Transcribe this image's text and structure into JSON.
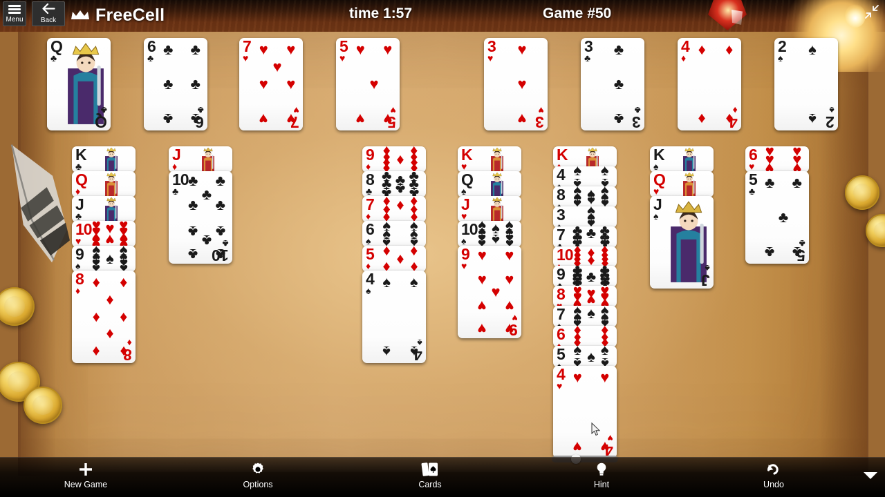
{
  "window": {
    "app_title": "FreeCell",
    "menu_label": "Menu",
    "back_label": "Back",
    "restore_icon": "restore-down-icon",
    "crown_icon": "crown-icon"
  },
  "status": {
    "time_label": "time 1:57",
    "game_label": "Game #50"
  },
  "toolbar": {
    "items": [
      {
        "label": "New Game",
        "icon": "plus-icon"
      },
      {
        "label": "Options",
        "icon": "gear-icon"
      },
      {
        "label": "Cards",
        "icon": "cards-icon"
      },
      {
        "label": "Hint",
        "icon": "lightbulb-icon"
      },
      {
        "label": "Undo",
        "icon": "undo-arrow-icon"
      }
    ],
    "more_icon": "chevron-down-icon"
  },
  "colors": {
    "red_suit": "#d40000",
    "black_suit": "#1a1a1a",
    "card_face": "#ffffff",
    "toolbar_bg": "#000000",
    "table": "#c2914f"
  },
  "board": {
    "free_cells": [
      {
        "rank": "Q",
        "suit": "clubs",
        "symbol": "♣",
        "color": "black",
        "court": true
      },
      {
        "rank": "6",
        "suit": "clubs",
        "symbol": "♣",
        "color": "black",
        "court": false
      },
      {
        "rank": "7",
        "suit": "hearts",
        "symbol": "♥",
        "color": "red",
        "court": false
      },
      {
        "rank": "5",
        "suit": "hearts",
        "symbol": "♥",
        "color": "red",
        "court": false
      }
    ],
    "foundations": [
      {
        "rank": "3",
        "suit": "hearts",
        "symbol": "♥",
        "color": "red",
        "court": false
      },
      {
        "rank": "3",
        "suit": "clubs",
        "symbol": "♣",
        "color": "black",
        "court": false
      },
      {
        "rank": "4",
        "suit": "diamonds",
        "symbol": "♦",
        "color": "red",
        "court": false
      },
      {
        "rank": "2",
        "suit": "spades",
        "symbol": "♠",
        "color": "black",
        "court": false
      }
    ],
    "columns": [
      {
        "cards": [
          {
            "rank": "K",
            "suit": "clubs",
            "symbol": "♣",
            "color": "black",
            "court": true
          },
          {
            "rank": "Q",
            "suit": "diamonds",
            "symbol": "♦",
            "color": "red",
            "court": true
          },
          {
            "rank": "J",
            "suit": "clubs",
            "symbol": "♣",
            "color": "black",
            "court": true
          },
          {
            "rank": "10",
            "suit": "hearts",
            "symbol": "♥",
            "color": "red",
            "court": false
          },
          {
            "rank": "9",
            "suit": "spades",
            "symbol": "♠",
            "color": "black",
            "court": false
          },
          {
            "rank": "8",
            "suit": "diamonds",
            "symbol": "♦",
            "color": "red",
            "court": false
          }
        ]
      },
      {
        "cards": [
          {
            "rank": "J",
            "suit": "diamonds",
            "symbol": "♦",
            "color": "red",
            "court": true
          },
          {
            "rank": "10",
            "suit": "clubs",
            "symbol": "♣",
            "color": "black",
            "court": false
          }
        ]
      },
      {
        "cards": []
      },
      {
        "cards": [
          {
            "rank": "9",
            "suit": "diamonds",
            "symbol": "♦",
            "color": "red",
            "court": false
          },
          {
            "rank": "8",
            "suit": "clubs",
            "symbol": "♣",
            "color": "black",
            "court": false
          },
          {
            "rank": "7",
            "suit": "diamonds",
            "symbol": "♦",
            "color": "red",
            "court": false
          },
          {
            "rank": "6",
            "suit": "spades",
            "symbol": "♠",
            "color": "black",
            "court": false
          },
          {
            "rank": "5",
            "suit": "diamonds",
            "symbol": "♦",
            "color": "red",
            "court": false
          },
          {
            "rank": "4",
            "suit": "spades",
            "symbol": "♠",
            "color": "black",
            "court": false
          }
        ]
      },
      {
        "cards": [
          {
            "rank": "K",
            "suit": "hearts",
            "symbol": "♥",
            "color": "red",
            "court": true
          },
          {
            "rank": "Q",
            "suit": "spades",
            "symbol": "♠",
            "color": "black",
            "court": true
          },
          {
            "rank": "J",
            "suit": "hearts",
            "symbol": "♥",
            "color": "red",
            "court": true
          },
          {
            "rank": "10",
            "suit": "spades",
            "symbol": "♠",
            "color": "black",
            "court": false
          },
          {
            "rank": "9",
            "suit": "hearts",
            "symbol": "♥",
            "color": "red",
            "court": false
          }
        ]
      },
      {
        "cards": [
          {
            "rank": "K",
            "suit": "diamonds",
            "symbol": "♦",
            "color": "red",
            "court": true
          },
          {
            "rank": "4",
            "suit": "spades",
            "symbol": "♠",
            "color": "black",
            "court": false
          },
          {
            "rank": "8",
            "suit": "spades",
            "symbol": "♠",
            "color": "black",
            "court": false
          },
          {
            "rank": "3",
            "suit": "spades",
            "symbol": "♠",
            "color": "black",
            "court": false
          },
          {
            "rank": "7",
            "suit": "clubs",
            "symbol": "♣",
            "color": "black",
            "court": false
          },
          {
            "rank": "10",
            "suit": "diamonds",
            "symbol": "♦",
            "color": "red",
            "court": false
          },
          {
            "rank": "9",
            "suit": "clubs",
            "symbol": "♣",
            "color": "black",
            "court": false
          },
          {
            "rank": "8",
            "suit": "hearts",
            "symbol": "♥",
            "color": "red",
            "court": false
          },
          {
            "rank": "7",
            "suit": "spades",
            "symbol": "♠",
            "color": "black",
            "court": false
          },
          {
            "rank": "6",
            "suit": "diamonds",
            "symbol": "♦",
            "color": "red",
            "court": false
          },
          {
            "rank": "5",
            "suit": "spades",
            "symbol": "♠",
            "color": "black",
            "court": false
          },
          {
            "rank": "4",
            "suit": "hearts",
            "symbol": "♥",
            "color": "red",
            "court": false
          }
        ]
      },
      {
        "cards": [
          {
            "rank": "K",
            "suit": "spades",
            "symbol": "♠",
            "color": "black",
            "court": true
          },
          {
            "rank": "Q",
            "suit": "hearts",
            "symbol": "♥",
            "color": "red",
            "court": true
          },
          {
            "rank": "J",
            "suit": "spades",
            "symbol": "♠",
            "color": "black",
            "court": true
          }
        ]
      },
      {
        "cards": [
          {
            "rank": "6",
            "suit": "hearts",
            "symbol": "♥",
            "color": "red",
            "court": false
          },
          {
            "rank": "5",
            "suit": "clubs",
            "symbol": "♣",
            "color": "black",
            "court": false
          }
        ]
      }
    ]
  }
}
